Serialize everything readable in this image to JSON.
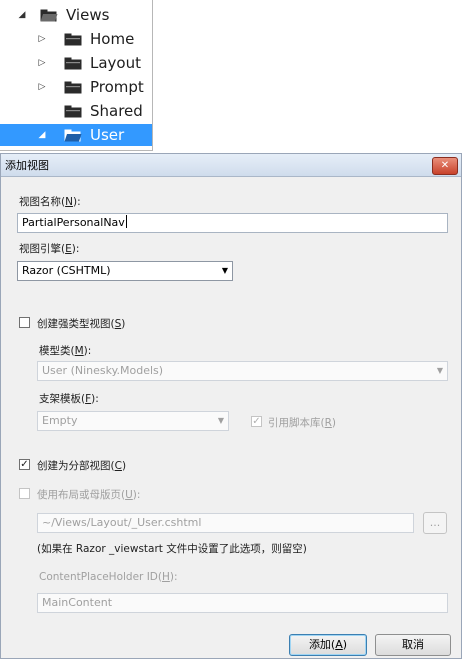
{
  "tree": {
    "items": [
      {
        "label": "Views",
        "expander": "◢",
        "icon": "folder-open-icon"
      },
      {
        "label": "Home",
        "expander": "▷",
        "icon": "folder-icon"
      },
      {
        "label": "Layout",
        "expander": "▷",
        "icon": "folder-icon"
      },
      {
        "label": "Prompt",
        "expander": "▷",
        "icon": "folder-icon"
      },
      {
        "label": "Shared",
        "expander": "",
        "icon": "folder-icon"
      },
      {
        "label": "User",
        "expander": "◢",
        "icon": "folder-open-icon",
        "selected": true
      }
    ]
  },
  "dialog": {
    "title": "添加视图",
    "close_label": "✕",
    "view_name_label": "视图名称(",
    "view_name_key": "N",
    "view_name_tail": "):",
    "view_name_value": "PartialPersonalNav",
    "engine_label": "视图引擎(",
    "engine_key": "E",
    "engine_tail": "):",
    "engine_value": "Razor (CSHTML)",
    "strong_type_label": "创建强类型视图(",
    "strong_type_key": "S",
    "strong_type_tail": ")",
    "strong_type_checked": false,
    "model_class_label": "模型类(",
    "model_class_key": "M",
    "model_class_tail": "):",
    "model_class_value": "User (Ninesky.Models)",
    "scaffold_label": "支架模板(",
    "scaffold_key": "F",
    "scaffold_tail": "):",
    "scaffold_value": "Empty",
    "script_lib_label": "引用脚本库(",
    "script_lib_key": "R",
    "script_lib_tail": ")",
    "script_lib_checked": true,
    "partial_label": "创建为分部视图(",
    "partial_key": "C",
    "partial_tail": ")",
    "partial_checked": true,
    "layout_label": "使用布局或母版页(",
    "layout_key": "U",
    "layout_tail": "):",
    "layout_checked": false,
    "layout_path": "~/Views/Layout/_User.cshtml",
    "browse_label": "...",
    "hint": "(如果在 Razor _viewstart 文件中设置了此选项，则留空)",
    "placeholder_label": "ContentPlaceHolder ID(",
    "placeholder_key": "H",
    "placeholder_tail": "):",
    "placeholder_value": "MainContent",
    "add_button": "添加(",
    "add_key": "A",
    "add_tail": ")",
    "cancel_button": "取消",
    "check_mark": "✓",
    "arrow": "▼"
  }
}
